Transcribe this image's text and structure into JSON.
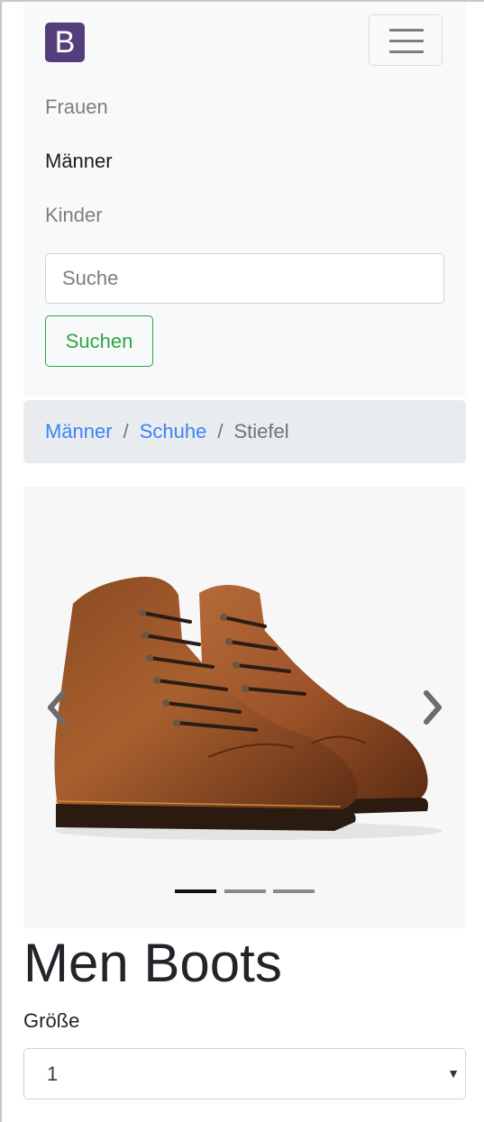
{
  "navbar": {
    "brand_letter": "B",
    "brand_color": "#563d7c",
    "toggler_icon": "hamburger-menu-icon",
    "links": [
      {
        "label": "Frauen",
        "active": false
      },
      {
        "label": "Männer",
        "active": true
      },
      {
        "label": "Kinder",
        "active": false
      }
    ],
    "search": {
      "placeholder": "Suche",
      "value": "",
      "button_label": "Suchen"
    }
  },
  "breadcrumb": {
    "items": [
      "Männer",
      "Schuhe",
      "Stiefel"
    ],
    "separator": "/",
    "link_color": "#3b82f6"
  },
  "carousel": {
    "prev_icon": "chevron-left-icon",
    "next_icon": "chevron-right-icon",
    "image": "brown-leather-cap-toe-boots",
    "slide_count": 3,
    "active_slide": 1
  },
  "product": {
    "title": "Men Boots",
    "size_label": "Größe",
    "size_selected": "1",
    "caret_icon": "caret-down-icon"
  },
  "colors": {
    "success": "#28a745",
    "text": "#212529"
  }
}
